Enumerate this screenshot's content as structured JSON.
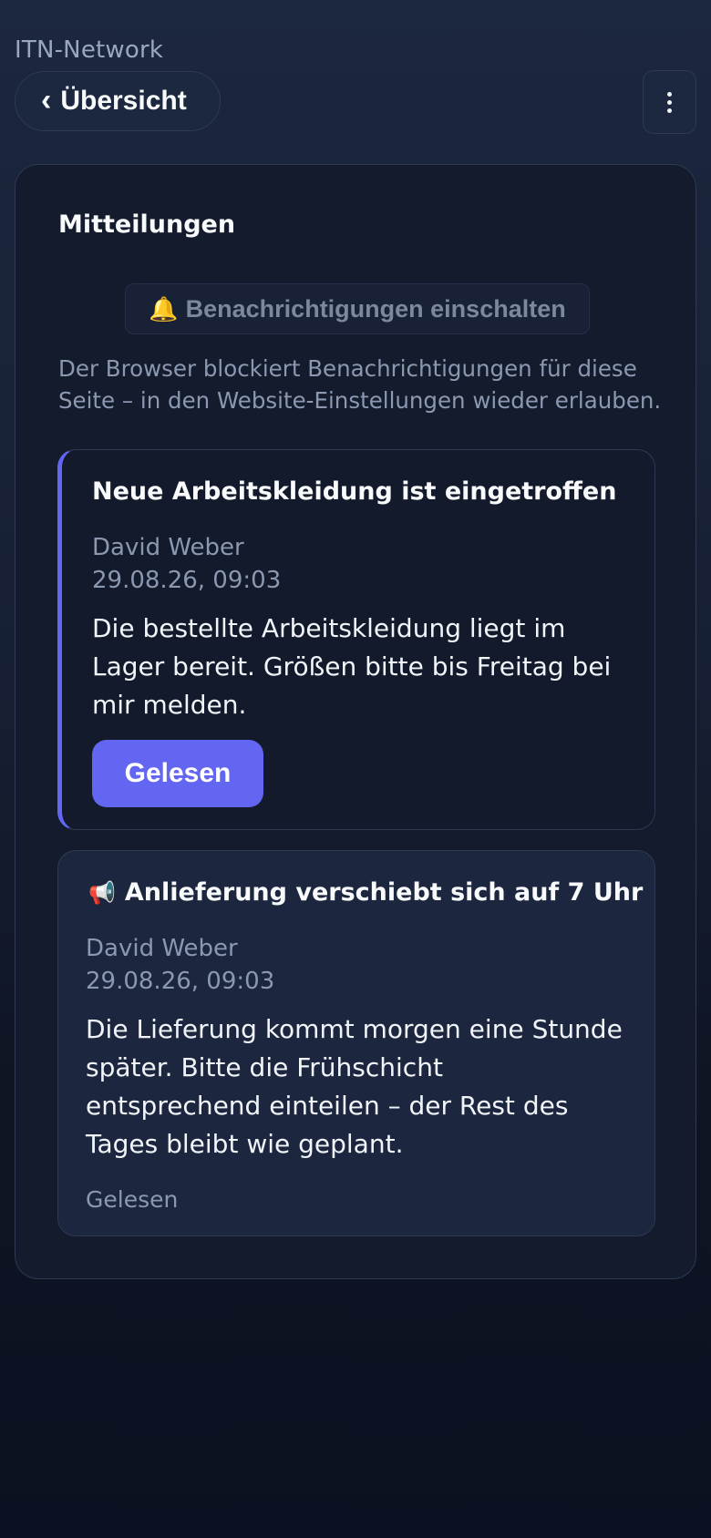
{
  "header": {
    "app_name": "ITN-Network",
    "back_label": "Übersicht",
    "back_chevron": "‹",
    "menu_icon": "vertical-dots-icon"
  },
  "panel": {
    "title": "Mitteilungen",
    "notify_button_icon": "🔔",
    "notify_button_label": "Benachrichtigungen einschalten",
    "blocked_hint": "Der Browser blockiert Benachrichtigungen für diese Seite – in den Website-Einstellungen wieder erlauben."
  },
  "messages": [
    {
      "status": "unread",
      "icon": "",
      "title": "Neue Arbeitskleidung ist eingetroffen",
      "author": "David Weber",
      "date": "29.08.26, 09:03",
      "body": "Die bestellte Arbeitskleidung liegt im Lager bereit. Größen bitte bis Freitag bei mir melden.",
      "action_label": "Gelesen"
    },
    {
      "status": "read",
      "icon": "📢",
      "title": "Anlieferung verschiebt sich auf 7 Uhr",
      "author": "David Weber",
      "date": "29.08.26, 09:03",
      "body": "Die Lieferung kommt morgen eine Stunde später. Bitte die Frühschicht entsprechend einteilen – der Rest des Tages bleibt wie geplant.",
      "status_label": "Gelesen"
    }
  ],
  "colors": {
    "accent": "#6366f1",
    "background_top": "#1c2740",
    "background_bottom": "#0b1120",
    "muted_text": "#8a98b2"
  }
}
